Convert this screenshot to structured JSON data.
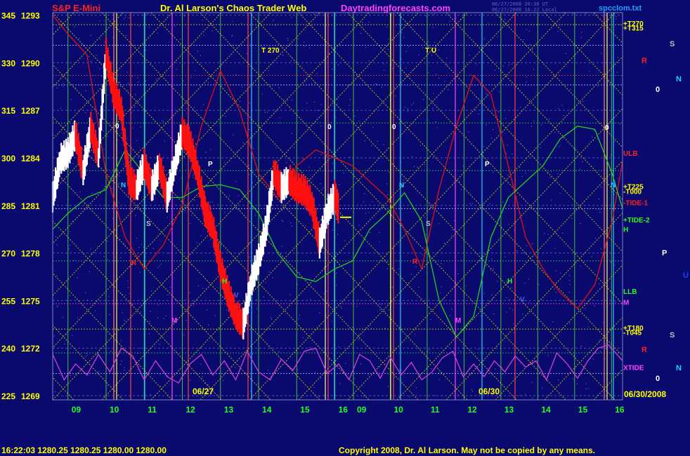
{
  "header": {
    "left_title": "S&P E-Mini",
    "center_title": "Dr. Al Larson's Chaos Trader Web",
    "site": "Daytradingforecasts.com",
    "timestamp_line1": "06/27/2008 20:30 UT",
    "timestamp_line2": "06/27/2008 16:22 Local",
    "filename": "spcclom.txt"
  },
  "footer": {
    "quote": "16:22:03  1280.25 1280.25 1280.00 1280.00",
    "copyright": "Copyright 2008, Dr. Al Larson. May not be copied by any means."
  },
  "colors": {
    "background": "#0a0a6e",
    "grid_green": "#3fbf3f",
    "diag_yellow": "#d8d800",
    "tide_red": "#e01010",
    "tide_green": "#20d020",
    "xtide_magenta": "#d040d0",
    "bar_white": "#ffffff",
    "bar_red": "#ff1010"
  },
  "chart_data": {
    "type": "line",
    "title": "S&P E-Mini",
    "ylim": [
      1269,
      1294
    ],
    "y_ticks": [
      {
        "left": "345",
        "right": "1293",
        "value": 1293
      },
      {
        "left": "330",
        "right": "1290",
        "value": 1290
      },
      {
        "left": "315",
        "right": "1287",
        "value": 1287
      },
      {
        "left": "300",
        "right": "1284",
        "value": 1284
      },
      {
        "left": "285",
        "right": "1281",
        "value": 1281
      },
      {
        "left": "270",
        "right": "1278",
        "value": 1278
      },
      {
        "left": "255",
        "right": "1275",
        "value": 1275
      },
      {
        "left": "240",
        "right": "1272",
        "value": 1272
      },
      {
        "left": "225",
        "right": "1269",
        "value": 1269
      }
    ],
    "x_ticks": [
      "09",
      "10",
      "11",
      "12",
      "13",
      "14",
      "15",
      "16",
      "09",
      "10",
      "11",
      "12",
      "13",
      "14",
      "15",
      "16"
    ],
    "date_labels": [
      "06/27",
      "06/30",
      "06/30/2008"
    ],
    "price_series": {
      "name": "price",
      "x_hours": [
        8.6,
        8.8,
        9.0,
        9.2,
        9.4,
        9.6,
        9.8,
        10.0,
        10.2,
        10.4,
        10.6,
        10.8,
        11.0,
        11.2,
        11.4,
        11.6,
        11.8,
        12.0,
        12.2,
        12.4,
        12.6,
        12.8,
        13.0,
        13.2,
        13.4,
        13.6,
        13.8,
        14.0,
        14.2,
        14.4,
        14.6,
        14.8,
        15.0,
        15.2,
        15.4,
        15.6,
        15.8,
        16.0,
        16.1
      ],
      "values": [
        1281.4,
        1283.8,
        1284.2,
        1285.4,
        1283.0,
        1285.8,
        1284.0,
        1290.5,
        1288.0,
        1287.0,
        1282.5,
        1282.0,
        1283.5,
        1282.0,
        1283.4,
        1281.4,
        1283.5,
        1285.5,
        1284.8,
        1283.0,
        1280.5,
        1279.5,
        1277.0,
        1275.3,
        1274.0,
        1273.4,
        1276.0,
        1277.5,
        1279.5,
        1283.0,
        1282.0,
        1282.5,
        1282.0,
        1281.8,
        1281.0,
        1278.5,
        1280.5,
        1281.5,
        1280.6
      ]
    },
    "red_tide": {
      "name": "-TIDE-1",
      "x_hours": [
        8.6,
        9.0,
        9.5,
        10.0,
        10.5,
        11.0,
        11.5,
        12.0,
        12.5,
        13.0,
        13.5,
        14.0,
        14.5,
        15.0,
        15.5,
        16.0,
        16.5,
        17.0,
        17.5,
        18.0,
        18.5,
        19.0,
        19.5,
        20.0,
        20.5,
        21.0,
        21.5,
        22.0,
        22.5,
        23.0,
        23.5,
        24.0,
        24.3
      ],
      "values": [
        1293,
        1291.8,
        1290.5,
        1283,
        1279,
        1277,
        1278.5,
        1281,
        1286,
        1289.5,
        1287,
        1283,
        1281.5,
        1283.5,
        1284.5,
        1284,
        1283.5,
        1282.5,
        1281.5,
        1279.5,
        1277,
        1282,
        1286,
        1289.2,
        1288,
        1283.5,
        1279,
        1277,
        1275.5,
        1274.5,
        1276,
        1280,
        1283.8
      ]
    },
    "green_tide": {
      "name": "+TIDE-2",
      "x_hours": [
        8.6,
        9.0,
        9.5,
        10.0,
        10.5,
        11.0,
        11.5,
        12.0,
        12.5,
        13.0,
        13.5,
        14.0,
        14.5,
        15.0,
        15.5,
        16.0,
        16.5,
        17.0,
        17.5,
        18.0,
        18.5,
        19.0,
        19.5,
        20.0,
        20.5,
        21.0,
        21.5,
        22.0,
        22.5,
        23.0,
        23.5,
        24.0,
        24.3
      ],
      "values": [
        1279.5,
        1280.5,
        1281.5,
        1282,
        1284.5,
        1283,
        1281.5,
        1281.5,
        1282.2,
        1282.3,
        1282,
        1280.5,
        1278,
        1276.5,
        1276.2,
        1277,
        1277.5,
        1279.5,
        1280.5,
        1281.8,
        1280,
        1275,
        1272.7,
        1274,
        1279,
        1281.5,
        1282.5,
        1283.5,
        1285.2,
        1286,
        1285.8,
        1283,
        1280.8
      ]
    },
    "xtide": {
      "name": "XTIDE",
      "x_hours": [
        8.6,
        8.9,
        9.2,
        9.5,
        9.8,
        10.1,
        10.4,
        10.7,
        11.0,
        11.3,
        11.6,
        11.9,
        12.2,
        12.5,
        12.8,
        13.1,
        13.4,
        13.7,
        14.0,
        14.3,
        14.6,
        14.9,
        15.2,
        15.5,
        15.8,
        16.1,
        16.4,
        16.7,
        17.0,
        17.3,
        17.6,
        17.9,
        18.2,
        18.5,
        18.8,
        19.1,
        19.4,
        19.7,
        20.0,
        20.3,
        20.6,
        20.9,
        21.2,
        21.5,
        21.8,
        22.1,
        22.4,
        22.7,
        23.0,
        23.3,
        23.6,
        23.9,
        24.3
      ],
      "values": [
        1271.6,
        1270.0,
        1271.0,
        1270.3,
        1271.6,
        1270.5,
        1272.0,
        1271.5,
        1270.0,
        1271.2,
        1270.2,
        1269.8,
        1271.0,
        1271.6,
        1270.3,
        1271.2,
        1270.0,
        1271.8,
        1270.5,
        1270.0,
        1271.3,
        1270.6,
        1271.8,
        1272.0,
        1270.4,
        1271.0,
        1270.0,
        1271.6,
        1271.2,
        1270.1,
        1271.4,
        1270.3,
        1271.1,
        1270.0,
        1270.5,
        1271.4,
        1271.8,
        1270.2,
        1271.0,
        1270.2,
        1271.2,
        1270.5,
        1271.5,
        1270.8,
        1271.2,
        1270.0,
        1271.7,
        1271.0,
        1270.1,
        1271.2,
        1272.0,
        1272.2,
        1271.2
      ]
    },
    "right_labels": [
      {
        "text": "+T270",
        "price": 1292.5,
        "color": "#ffff00"
      },
      {
        "text": "+T315",
        "price": 1292.2,
        "color": "#ffff00"
      },
      {
        "text": "ULB",
        "price": 1284.3,
        "color": "#ff2020"
      },
      {
        "text": "+T225",
        "price": 1282.2,
        "color": "#ffff00"
      },
      {
        "text": "-T000",
        "price": 1281.9,
        "color": "#ffff00"
      },
      {
        "text": "-TIDE-1",
        "price": 1281.2,
        "color": "#ff2020"
      },
      {
        "text": "+TIDE-2",
        "price": 1280.1,
        "color": "#20ff20"
      },
      {
        "text": "H",
        "price": 1279.5,
        "color": "#20ff20"
      },
      {
        "text": "LLB",
        "price": 1275.6,
        "color": "#20ff20"
      },
      {
        "text": "M",
        "price": 1274.9,
        "color": "#ff40ff"
      },
      {
        "text": "+T180",
        "price": 1273.3,
        "color": "#ffff00"
      },
      {
        "text": "-T045",
        "price": 1273.0,
        "color": "#ffff00"
      },
      {
        "text": "XTIDE",
        "price": 1270.8,
        "color": "#ff40ff"
      }
    ],
    "planet_labels": [
      {
        "text": "S",
        "color": "#c0c0c0"
      },
      {
        "text": "R",
        "color": "#ff2020"
      },
      {
        "text": "N",
        "color": "#20d0ff"
      },
      {
        "text": "0",
        "color": "#ffffff"
      },
      {
        "text": "P",
        "color": "#ffffff"
      },
      {
        "text": "U",
        "color": "#2040ff"
      },
      {
        "text": "S",
        "color": "#c0c0c0"
      },
      {
        "text": "R",
        "color": "#ff2020"
      },
      {
        "text": "N",
        "color": "#20d0ff"
      },
      {
        "text": "0",
        "color": "#ffffff"
      }
    ],
    "in_chart_labels": [
      {
        "text": "T 270",
        "color": "#ffff00"
      },
      {
        "text": "T U",
        "color": "#ffff00"
      },
      {
        "text": "0",
        "color": "#ffffff"
      },
      {
        "text": "0",
        "color": "#ffffff"
      },
      {
        "text": "0",
        "color": "#ffffff"
      },
      {
        "text": "0",
        "color": "#ffffff"
      },
      {
        "text": "N",
        "color": "#20d0ff"
      },
      {
        "text": "N",
        "color": "#20d0ff"
      },
      {
        "text": "N",
        "color": "#20d0ff"
      },
      {
        "text": "S",
        "color": "#c0c0c0"
      },
      {
        "text": "S",
        "color": "#c0c0c0"
      },
      {
        "text": "P",
        "color": "#ffffff"
      },
      {
        "text": "P",
        "color": "#ffffff"
      },
      {
        "text": "R",
        "color": "#ff2020"
      },
      {
        "text": "R",
        "color": "#ff2020"
      },
      {
        "text": "M",
        "color": "#ff40ff"
      },
      {
        "text": "M",
        "color": "#ff40ff"
      },
      {
        "text": "H",
        "color": "#20ff20"
      },
      {
        "text": "H",
        "color": "#20ff20"
      },
      {
        "text": "V",
        "color": "#4060ff"
      },
      {
        "text": "V",
        "color": "#4060ff"
      }
    ],
    "grid": true
  }
}
